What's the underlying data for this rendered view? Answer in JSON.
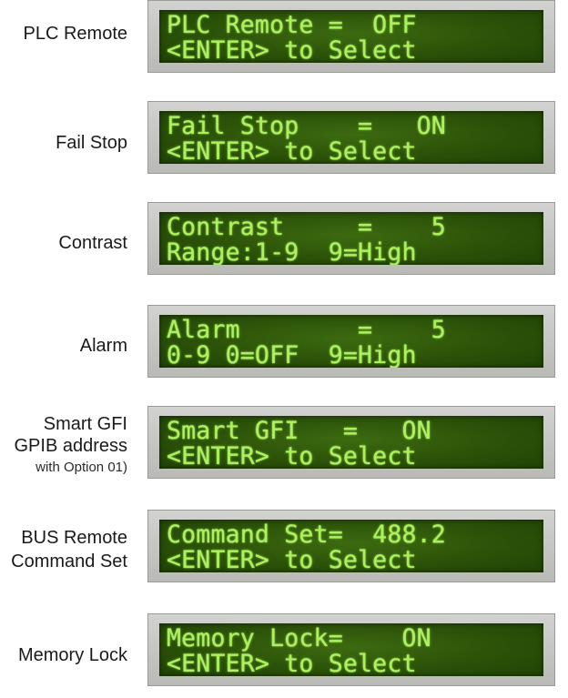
{
  "menu": [
    {
      "label_lines": [
        "PLC Remote"
      ],
      "display": [
        "PLC Remote =  OFF",
        "<ENTER> to Select"
      ]
    },
    {
      "label_lines": [
        "Fail Stop"
      ],
      "display": [
        "Fail Stop    =   ON",
        "<ENTER> to Select"
      ]
    },
    {
      "label_lines": [
        "Contrast"
      ],
      "display": [
        "Contrast     =    5",
        "Range:1-9  9=High"
      ]
    },
    {
      "label_lines": [
        "Alarm"
      ],
      "display": [
        "Alarm        =    5",
        "0-9 0=OFF  9=High"
      ]
    },
    {
      "label_lines": [
        "Smart GFI",
        "GPIB address",
        "with Option 01)"
      ],
      "display": [
        "Smart GFI   =   ON",
        "<ENTER> to Select"
      ]
    },
    {
      "label_lines": [
        "BUS Remote",
        "Command Set"
      ],
      "display": [
        "Command Set=  488.2",
        "<ENTER> to Select"
      ]
    },
    {
      "label_lines": [
        "Memory Lock"
      ],
      "display": [
        "Memory Lock=    ON",
        "<ENTER> to Select"
      ]
    }
  ]
}
